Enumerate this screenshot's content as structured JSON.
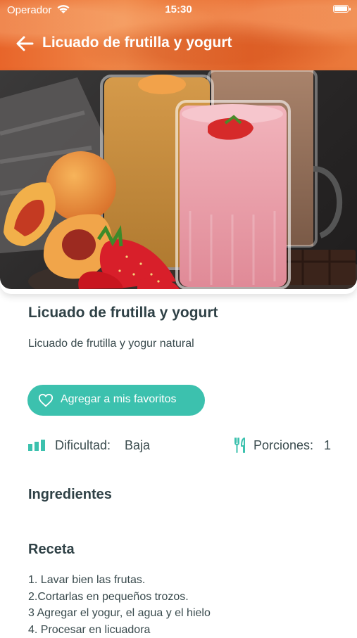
{
  "status": {
    "carrier": "Operador",
    "time": "15:30"
  },
  "nav": {
    "title": "Licuado de frutilla y yogurt"
  },
  "recipe": {
    "title": "Licuado de frutilla y yogurt",
    "description": "Licuado de frutilla y yogur natural",
    "favorite_label": "Agregar a mis favoritos",
    "difficulty_label": "Dificultad:",
    "difficulty_value": "Baja",
    "portions_label": "Porciones:",
    "portions_value": "1"
  },
  "sections": {
    "ingredients": "Ingredientes",
    "recipe": "Receta"
  },
  "steps": [
    "1. Lavar bien las frutas.",
    "2.Cortarlas en pequeños trozos.",
    "3 Agregar el yogur, el agua y el hielo",
    "4. Procesar en licuadora"
  ],
  "colors": {
    "header": "#e8652a",
    "accent": "#3cc1ae",
    "text": "#2f4146"
  },
  "icons": {
    "back": "arrow-left-icon",
    "heart": "heart-icon",
    "difficulty": "bar-chart-icon",
    "portions": "fork-knife-icon"
  }
}
